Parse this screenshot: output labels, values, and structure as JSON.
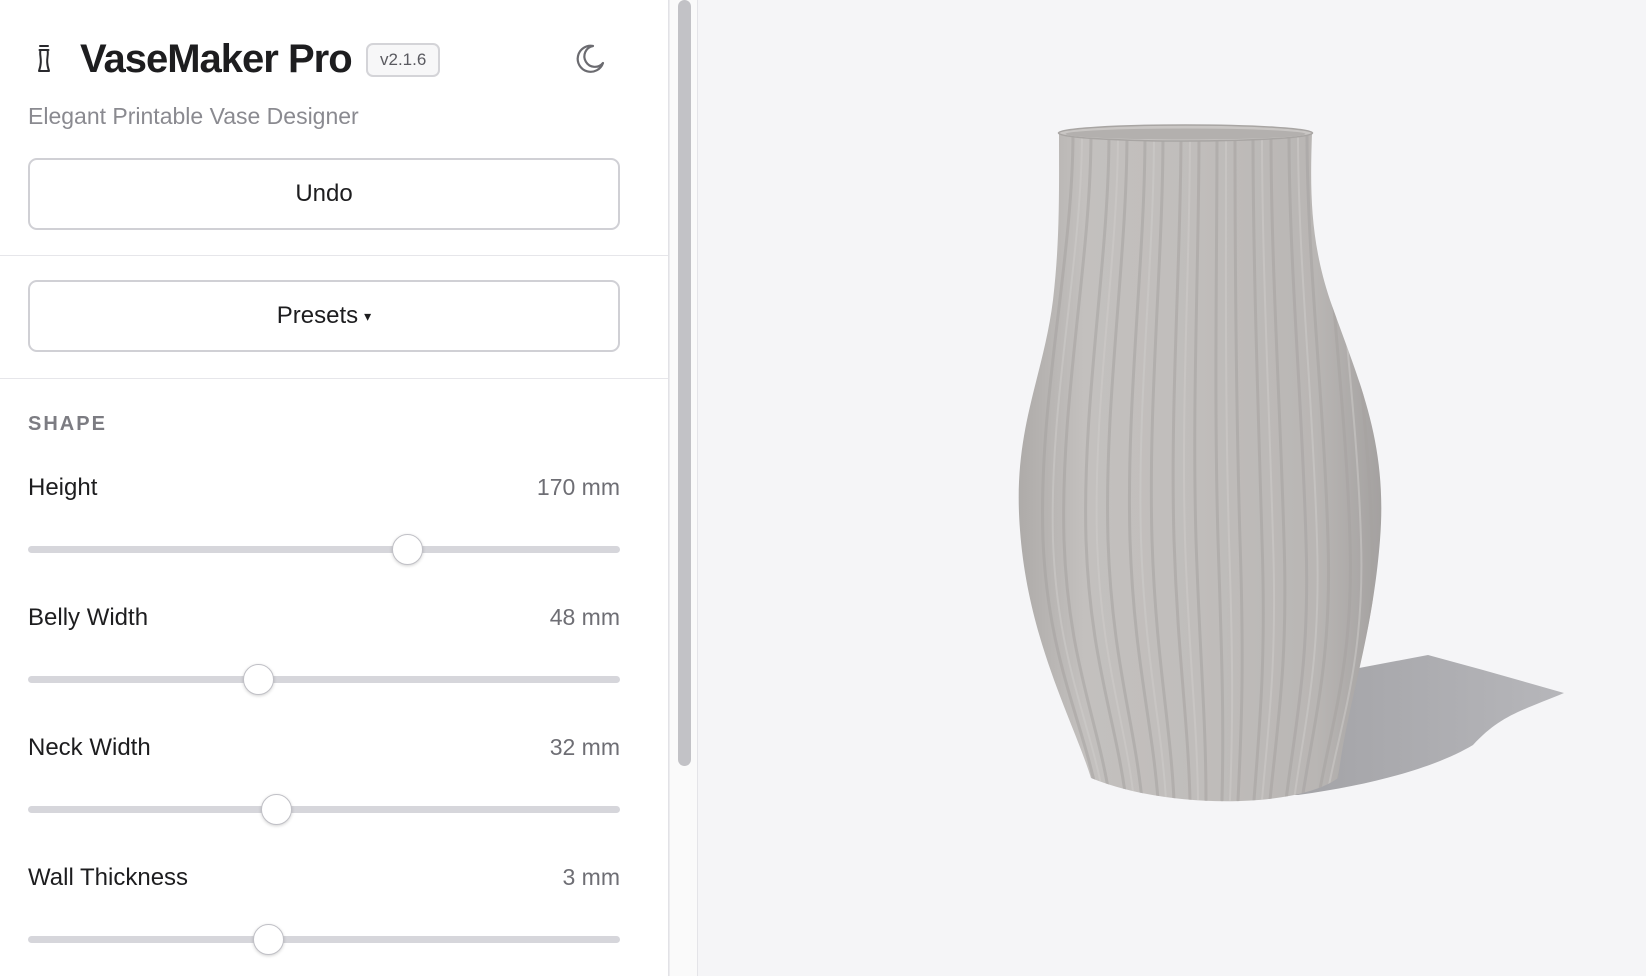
{
  "app": {
    "title": "VaseMaker Pro",
    "version": "v2.1.6",
    "subtitle": "Elegant Printable Vase Designer",
    "app_icon": "vase-icon",
    "theme_icon": "moon-icon"
  },
  "actions": {
    "undo_label": "Undo",
    "presets_label": "Presets",
    "presets_caret": "▾"
  },
  "shape": {
    "section_title": "SHAPE",
    "params": [
      {
        "label": "Height",
        "value_text": "170 mm",
        "position": 0.641
      },
      {
        "label": "Belly Width",
        "value_text": "48 mm",
        "position": 0.389
      },
      {
        "label": "Neck Width",
        "value_text": "32 mm",
        "position": 0.419
      },
      {
        "label": "Wall Thickness",
        "value_text": "3 mm",
        "position": 0.405
      }
    ]
  },
  "colors": {
    "vase": "#bdbab8",
    "shadow": "#a9a9ad",
    "background": "#f5f5f7",
    "track": "#d6d6db"
  }
}
